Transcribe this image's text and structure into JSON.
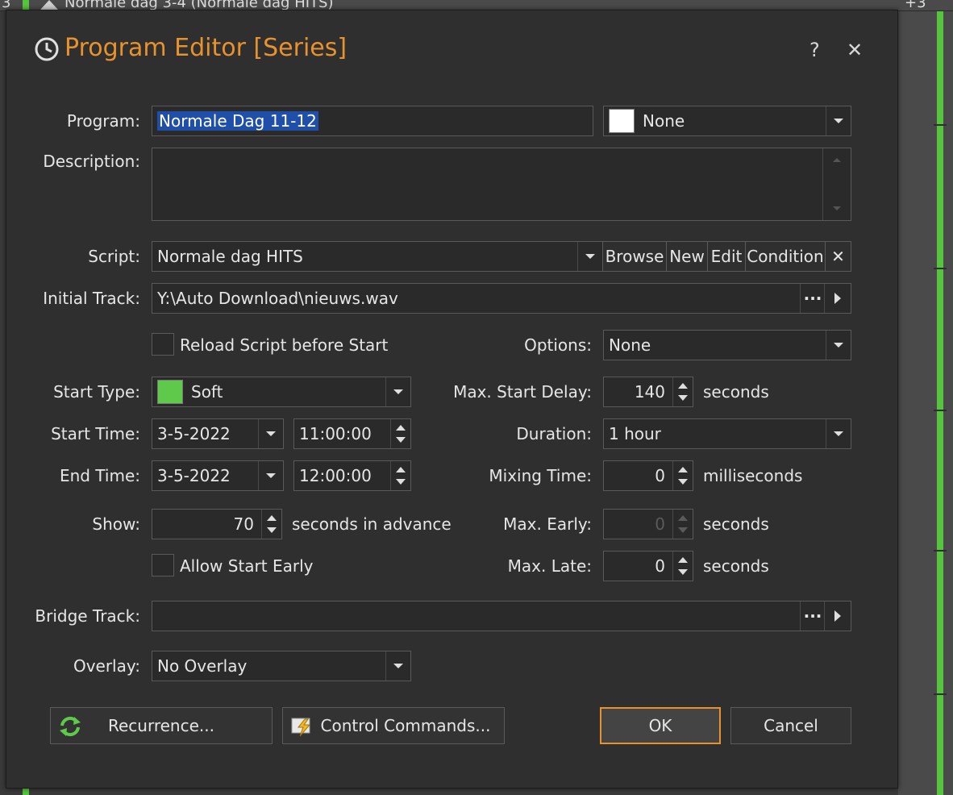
{
  "background": {
    "row_text": "Normale dag 3-4 (Normale dag HITS)",
    "row_num_left": "3",
    "row_num_right": "+3"
  },
  "dialog": {
    "title": "Program Editor [Series]",
    "help": "?",
    "close": "✕"
  },
  "program": {
    "label": "Program:",
    "value": "Normale Dag 11-12",
    "color_value": "None",
    "color_swatch": "#ffffff"
  },
  "description": {
    "label": "Description:",
    "value": ""
  },
  "script": {
    "label": "Script:",
    "value": "Normale dag HITS",
    "browse": "Browse",
    "new": "New",
    "edit": "Edit",
    "condition": "Condition",
    "clear": "✕"
  },
  "initial_track": {
    "label": "Initial Track:",
    "value": "Y:\\Auto Download\\nieuws.wav",
    "more": "···"
  },
  "reload": {
    "label": "Reload Script before Start",
    "checked": false
  },
  "options": {
    "label": "Options:",
    "value": "None"
  },
  "start_type": {
    "label": "Start Type:",
    "value": "Soft",
    "swatch": "#5ec94a"
  },
  "max_start_delay": {
    "label": "Max. Start Delay:",
    "value": "140",
    "unit": "seconds"
  },
  "start_time": {
    "label": "Start Time:",
    "date": "3-5-2022",
    "time": "11:00:00"
  },
  "duration": {
    "label": "Duration:",
    "value": "1 hour"
  },
  "end_time": {
    "label": "End Time:",
    "date": "3-5-2022",
    "time": "12:00:00"
  },
  "mixing_time": {
    "label": "Mixing Time:",
    "value": "0",
    "unit": "milliseconds"
  },
  "show": {
    "label": "Show:",
    "value": "70",
    "unit": "seconds in advance"
  },
  "max_early": {
    "label": "Max. Early:",
    "value": "0",
    "unit": "seconds"
  },
  "allow_early": {
    "label": "Allow Start Early",
    "checked": false
  },
  "max_late": {
    "label": "Max. Late:",
    "value": "0",
    "unit": "seconds"
  },
  "bridge_track": {
    "label": "Bridge Track:",
    "value": "",
    "more": "···"
  },
  "overlay": {
    "label": "Overlay:",
    "value": "No Overlay"
  },
  "buttons": {
    "recurrence": "Recurrence...",
    "control_commands": "Control Commands...",
    "ok": "OK",
    "cancel": "Cancel"
  },
  "colors": {
    "accent": "#e8922e",
    "selection": "#1f4fa8",
    "green": "#56c43e"
  }
}
